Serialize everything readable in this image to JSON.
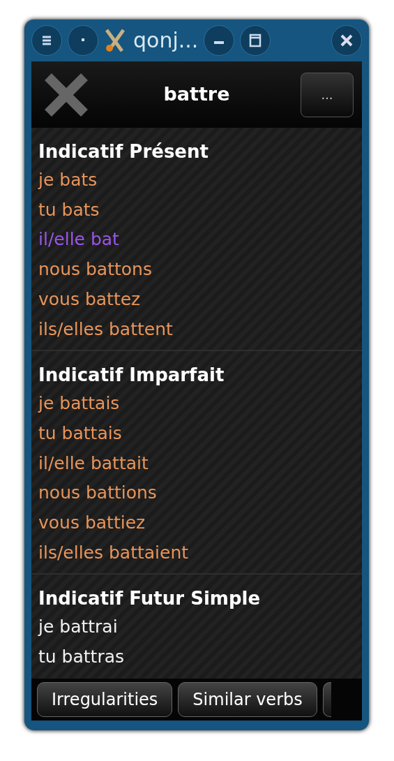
{
  "window": {
    "title": "qonj..."
  },
  "header": {
    "verb": "battre",
    "menu_button": "..."
  },
  "sections": [
    {
      "title": "Indicatif Présent",
      "forms": [
        {
          "text": "je bats",
          "color": "#e8955a"
        },
        {
          "text": "tu bats",
          "color": "#e8955a"
        },
        {
          "text": "il/elle bat",
          "color": "#9a55e8"
        },
        {
          "text": "nous battons",
          "color": "#e8955a"
        },
        {
          "text": "vous battez",
          "color": "#e8955a"
        },
        {
          "text": "ils/elles battent",
          "color": "#e8955a"
        }
      ]
    },
    {
      "title": "Indicatif Imparfait",
      "forms": [
        {
          "text": "je battais",
          "color": "#e8955a"
        },
        {
          "text": "tu battais",
          "color": "#e8955a"
        },
        {
          "text": "il/elle battait",
          "color": "#e8955a"
        },
        {
          "text": "nous battions",
          "color": "#e8955a"
        },
        {
          "text": "vous battiez",
          "color": "#e8955a"
        },
        {
          "text": "ils/elles battaient",
          "color": "#e8955a"
        }
      ]
    },
    {
      "title": "Indicatif Futur Simple",
      "forms": [
        {
          "text": "je battrai",
          "color": "#f2f2f2"
        },
        {
          "text": "tu battras",
          "color": "#f2f2f2"
        }
      ]
    }
  ],
  "buttons": [
    "Irregularities",
    "Similar verbs"
  ]
}
